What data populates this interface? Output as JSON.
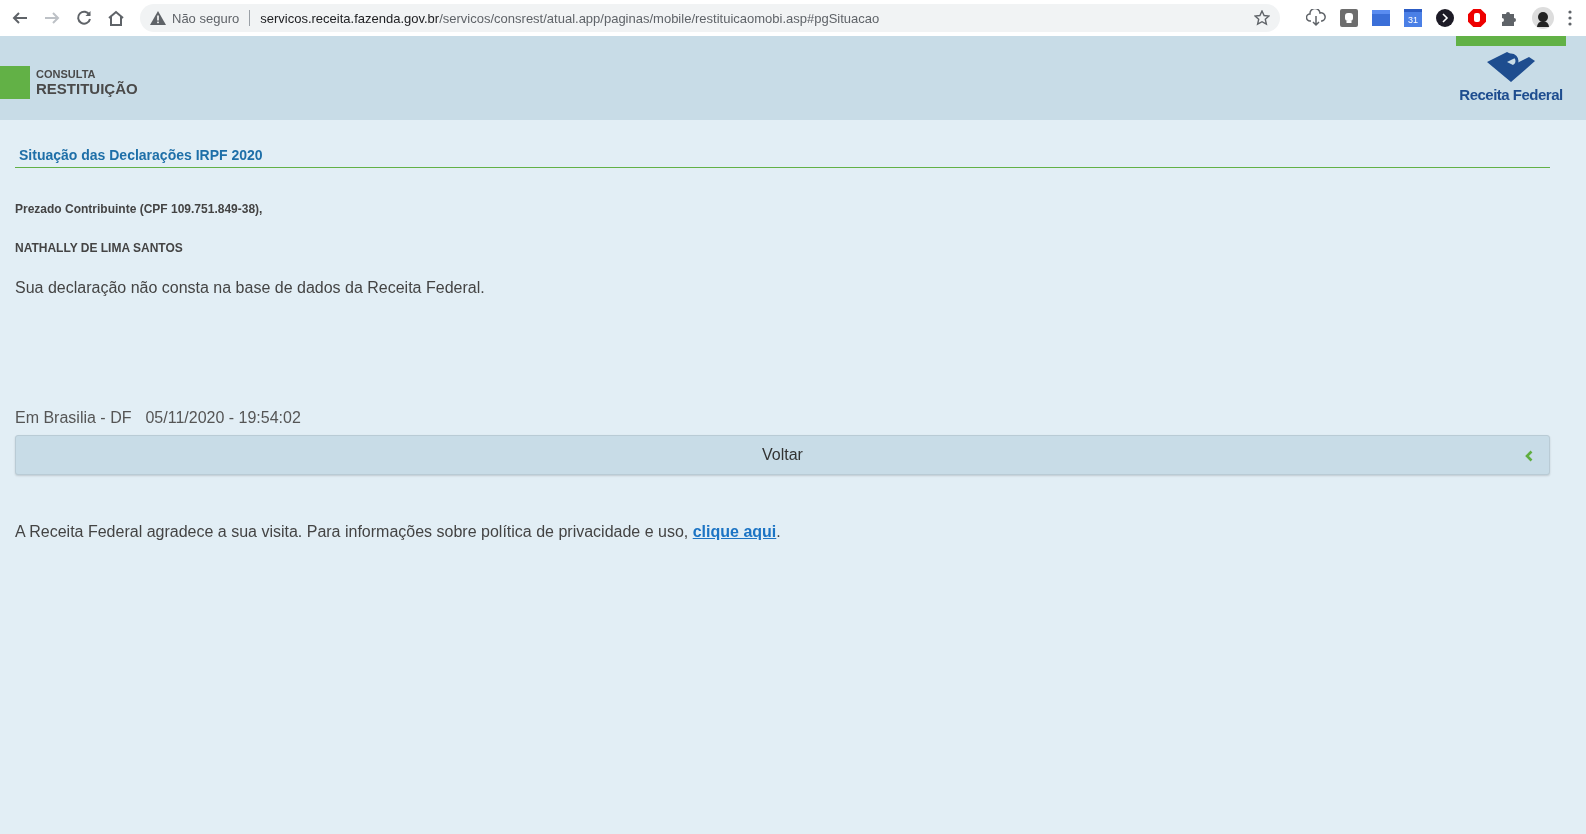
{
  "browser": {
    "security_label": "Não seguro",
    "url_host": "servicos.receita.fazenda.gov.br",
    "url_path": "/servicos/consrest/atual.app/paginas/mobile/restituicaomobi.asp#pgSituacao",
    "calendar_day": "31",
    "back_disabled": false,
    "forward_disabled": true
  },
  "header": {
    "kicker": "CONSULTA",
    "title": "RESTITUIÇÃO",
    "logo_text": "Receita Federal"
  },
  "section_title": "Situação das Declarações IRPF 2020",
  "greeting": "Prezado Contribuinte (CPF 109.751.849-38),",
  "name": "NATHALLY DE LIMA SANTOS",
  "message": "Sua declaração não consta na base de dados da Receita Federal.",
  "place": "Em Brasilia - DF",
  "timestamp": "05/11/2020 - 19:54:02",
  "back_button": "Voltar",
  "footer": {
    "text": "A Receita Federal agradece a sua visita. Para informações sobre política de privacidade e uso, ",
    "link": "clique aqui",
    "end": "."
  }
}
